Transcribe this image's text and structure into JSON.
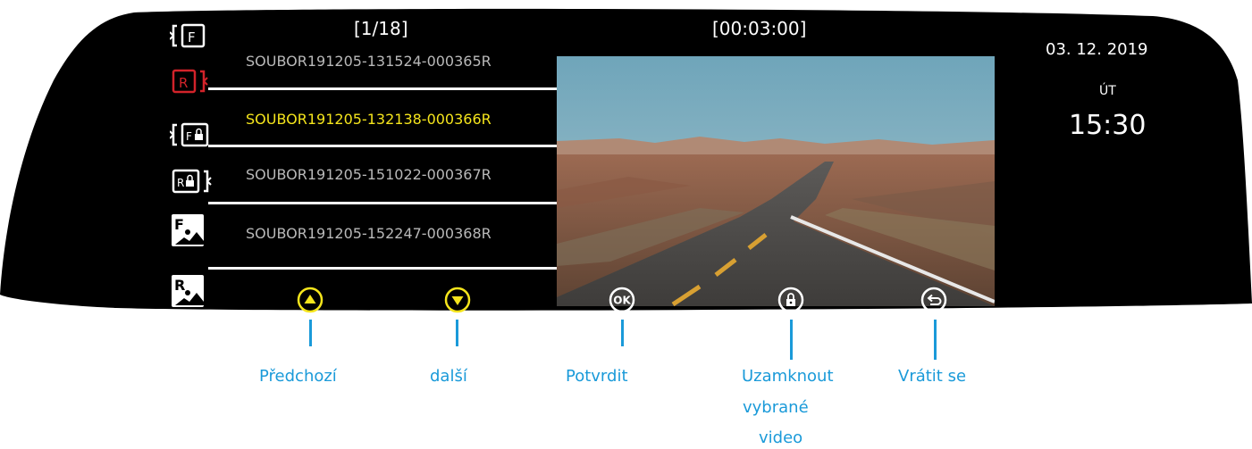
{
  "counter": {
    "file_index": "[1/18]",
    "duration": "[00:03:00]"
  },
  "clock": {
    "date": "03. 12. 2019",
    "weekday": "ÚT",
    "time": "15:30"
  },
  "files": [
    {
      "name": "SOUBOR191205-131524-000365R",
      "selected": false
    },
    {
      "name": "SOUBOR191205-132138-000366R",
      "selected": true
    },
    {
      "name": "SOUBOR191205-151022-000367R",
      "selected": false
    },
    {
      "name": "SOUBOR191205-152247-000368R",
      "selected": false
    }
  ],
  "side_icons": {
    "front": {
      "name": "front-video-icon",
      "letter": "F"
    },
    "rear": {
      "name": "rear-video-icon",
      "letter": "R"
    },
    "front_locked": {
      "name": "front-locked-video-icon",
      "letter": "F"
    },
    "rear_locked": {
      "name": "rear-locked-video-icon",
      "letter": "R"
    },
    "front_photo": {
      "name": "front-photo-icon",
      "letter": "F"
    },
    "rear_photo": {
      "name": "rear-photo-icon",
      "letter": "R"
    }
  },
  "controls": {
    "previous": {
      "icon": "up-arrow-icon",
      "label": "Předchozí"
    },
    "next": {
      "icon": "down-arrow-icon",
      "label": "další"
    },
    "confirm": {
      "icon": "ok-icon",
      "icon_text": "OK",
      "label": "Potvrdit"
    },
    "lock": {
      "icon": "lock-icon",
      "label_lines": [
        "Uzamknout",
        "vybrané",
        "video"
      ]
    },
    "back": {
      "icon": "return-icon",
      "label": "Vrátit se"
    }
  },
  "colors": {
    "screen_bg": "#000000",
    "selected_text": "#f5e51c",
    "normal_text": "#b9b9b9",
    "rear_active": "#d2232a",
    "arrow_accent": "#f5e51c",
    "callout": "#1a9ad9"
  }
}
